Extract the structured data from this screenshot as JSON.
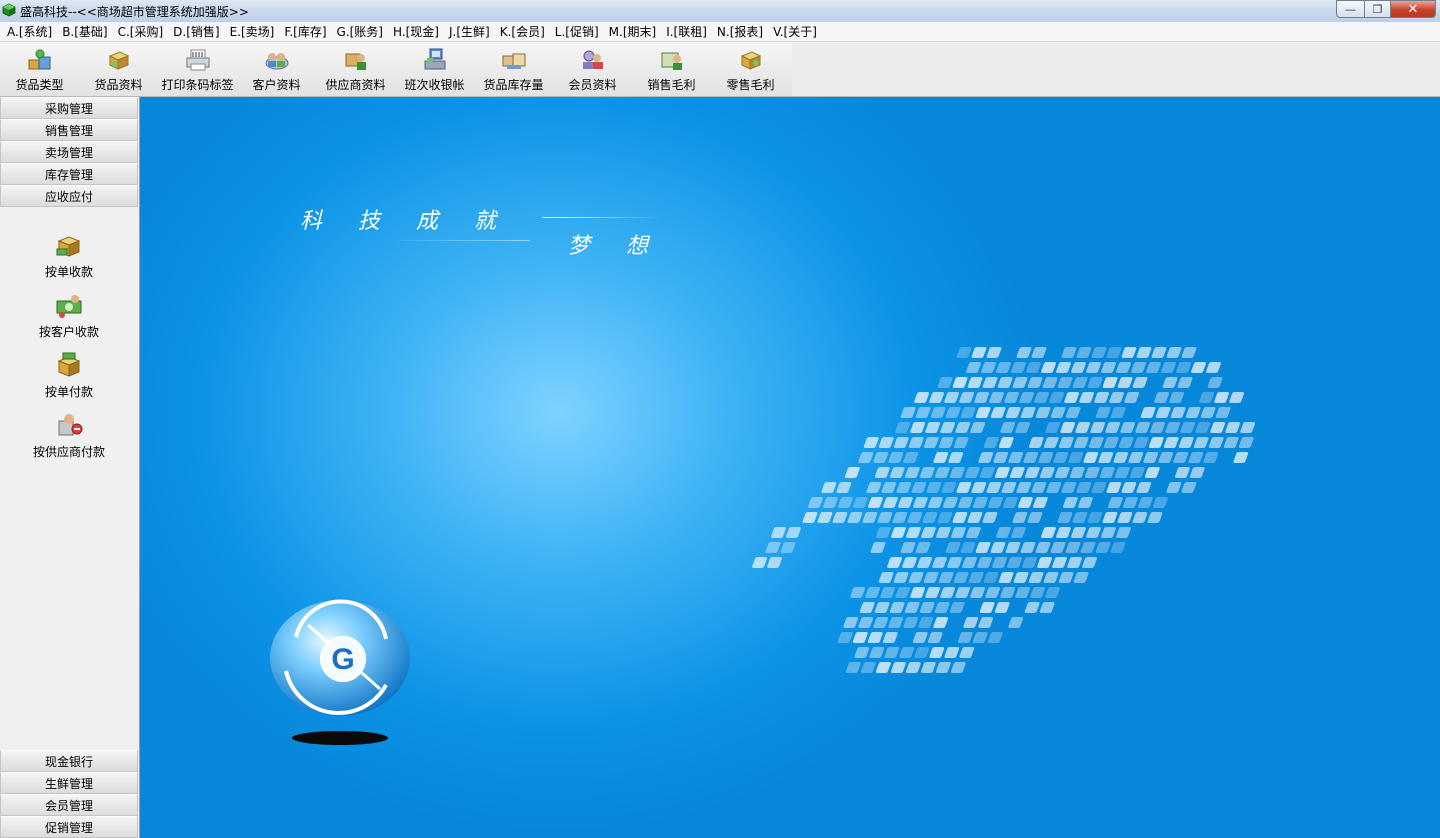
{
  "window": {
    "title": "盛高科技--<<商场超市管理系统加强版>>",
    "min_label": "—",
    "max_label": "❐",
    "close_label": "✕"
  },
  "menu": [
    "A.[系统]",
    "B.[基础]",
    "C.[采购]",
    "D.[销售]",
    "E.[卖场]",
    "F.[库存]",
    "G.[账务]",
    "H.[现金]",
    "J.[生鲜]",
    "K.[会员]",
    "L.[促销]",
    "M.[期末]",
    "I.[联租]",
    "N.[报表]",
    "V.[关于]"
  ],
  "toolbar": [
    {
      "label": "货品类型",
      "icon": "goods-type-icon"
    },
    {
      "label": "货品资料",
      "icon": "goods-info-icon"
    },
    {
      "label": "打印条码标签",
      "icon": "print-barcode-icon"
    },
    {
      "label": "客户资料",
      "icon": "customer-icon"
    },
    {
      "label": "供应商资料",
      "icon": "supplier-icon"
    },
    {
      "label": "班次收银帐",
      "icon": "cashier-shift-icon"
    },
    {
      "label": "货品库存量",
      "icon": "inventory-icon"
    },
    {
      "label": "会员资料",
      "icon": "member-icon"
    },
    {
      "label": "销售毛利",
      "icon": "sales-profit-icon"
    },
    {
      "label": "零售毛利",
      "icon": "retail-profit-icon"
    }
  ],
  "sidebar": {
    "top_groups": [
      "采购管理",
      "销售管理",
      "卖场管理",
      "库存管理",
      "应收应付"
    ],
    "tasks": [
      {
        "label": "按单收款",
        "icon": "receive-by-order-icon"
      },
      {
        "label": "按客户收款",
        "icon": "receive-by-customer-icon"
      },
      {
        "label": "按单付款",
        "icon": "pay-by-order-icon"
      },
      {
        "label": "按供应商付款",
        "icon": "pay-by-supplier-icon"
      }
    ],
    "bottom_groups": [
      "现金银行",
      "生鲜管理",
      "会员管理",
      "促销管理"
    ]
  },
  "main": {
    "slogan_line1": "科技成就",
    "slogan_line2": "梦想"
  },
  "colors": {
    "background_blue": "#0c93e6",
    "highlight_blue": "#7ed2ff"
  }
}
